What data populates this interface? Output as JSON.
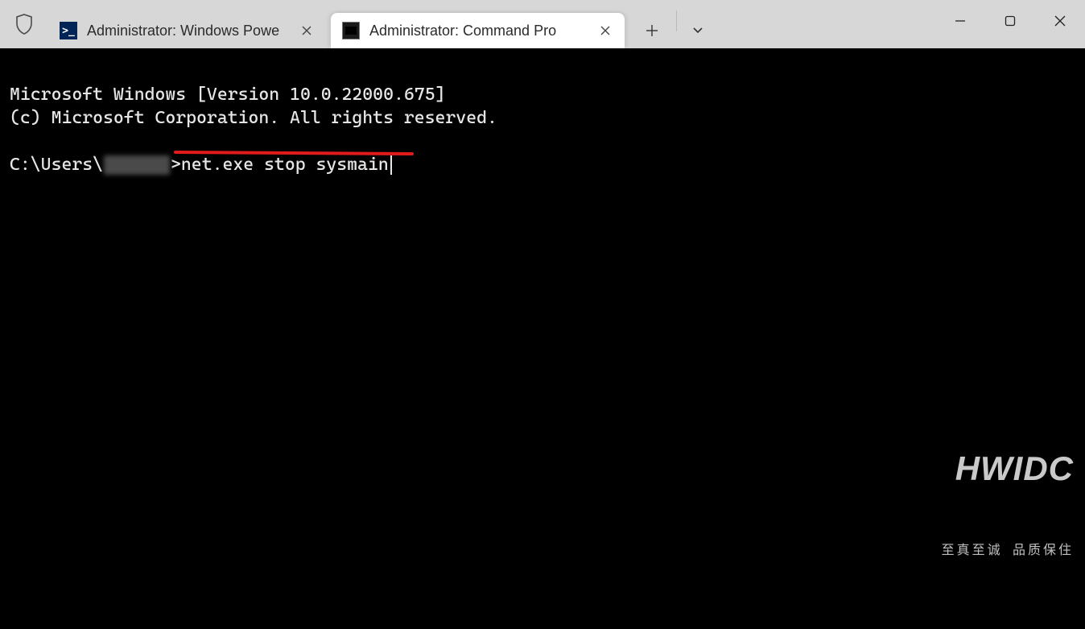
{
  "tabs": [
    {
      "label": "Administrator: Windows Powe",
      "icon": "powershell-icon"
    },
    {
      "label": "Administrator: Command Pro",
      "icon": "cmd-icon"
    }
  ],
  "terminal": {
    "line1": "Microsoft Windows [Version 10.0.22000.675]",
    "line2": "(c) Microsoft Corporation. All rights reserved.",
    "prompt_prefix": "C:\\Users\\",
    "prompt_blurred_user": "",
    "prompt_suffix": ">",
    "command": "net.exe stop sysmain"
  },
  "watermark": {
    "big": "HWIDC",
    "small": "至真至诚 品质保住"
  },
  "annotation": {
    "underline_color": "#e11b1b"
  }
}
